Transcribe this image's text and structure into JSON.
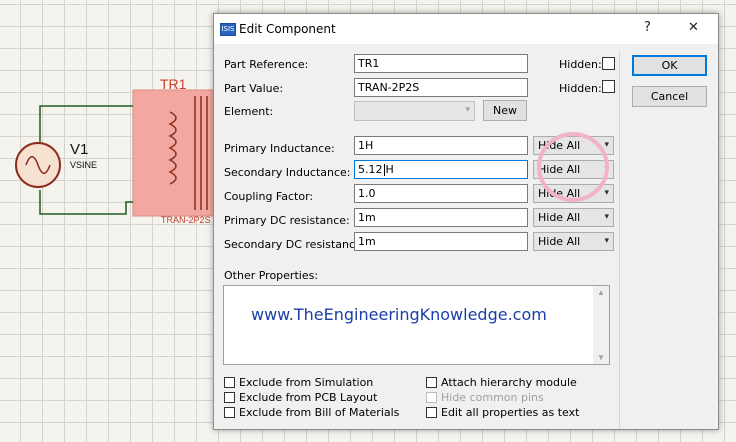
{
  "schematic": {
    "source_name": "V1",
    "source_type": "VSINE",
    "transformer_ref": "TR1",
    "transformer_type": "TRAN-2P2S"
  },
  "dialog": {
    "title": "Edit Component",
    "help_label": "?",
    "close_label": "✕",
    "fields": {
      "part_reference_label": "Part Reference:",
      "part_reference_value": "TR1",
      "part_value_label": "Part Value:",
      "part_value_value": "TRAN-2P2S",
      "element_label": "Element:",
      "element_value": "",
      "new_button": "New",
      "hidden_label": "Hidden:",
      "primary_inductance_label": "Primary Inductance:",
      "primary_inductance_value": "1H",
      "secondary_inductance_label": "Secondary Inductance:",
      "secondary_inductance_value_before_caret": "5.12",
      "secondary_inductance_value_after_caret": "H",
      "coupling_factor_label": "Coupling Factor:",
      "coupling_factor_value": "1.0",
      "primary_dc_label": "Primary DC resistance:",
      "primary_dc_value": "1m",
      "secondary_dc_label": "Secondary DC resistance:",
      "secondary_dc_value": "1m",
      "hide_all": "Hide All",
      "other_properties_label": "Other Properties:",
      "other_properties_text": "www.TheEngineeringKnowledge.com"
    },
    "buttons": {
      "ok": "OK",
      "cancel": "Cancel"
    },
    "checkboxes": {
      "exclude_simulation": "Exclude from Simulation",
      "exclude_pcb": "Exclude from PCB Layout",
      "exclude_bom": "Exclude from Bill of Materials",
      "attach_hierarchy": "Attach hierarchy module",
      "hide_common_pins": "Hide common pins",
      "edit_all_text": "Edit all properties as text"
    }
  }
}
